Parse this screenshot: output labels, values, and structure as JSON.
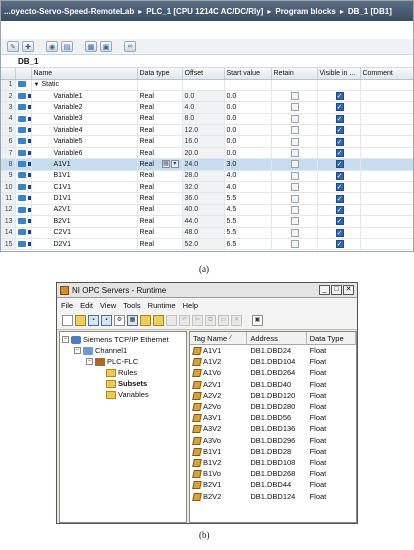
{
  "panel_a": {
    "breadcrumb": [
      "...oyecto-Servo-Speed-RemoteLab",
      "PLC_1 [CPU 1214C AC/DC/Rly]",
      "Program blocks",
      "DB_1 [DB1]"
    ],
    "block_title": "DB_1",
    "columns": [
      "Name",
      "Data type",
      "Offset",
      "Start value",
      "Retain",
      "Visible in ...",
      "Comment"
    ],
    "rows": [
      {
        "num": "1",
        "name": "Static",
        "type": "",
        "offset": "",
        "start": "",
        "header": true
      },
      {
        "num": "2",
        "name": "Variable1",
        "type": "Real",
        "offset": "0.0",
        "start": "0.0"
      },
      {
        "num": "3",
        "name": "Variable2",
        "type": "Real",
        "offset": "4.0",
        "start": "0.0"
      },
      {
        "num": "4",
        "name": "Variable3",
        "type": "Real",
        "offset": "8.0",
        "start": "0.0"
      },
      {
        "num": "5",
        "name": "Variable4",
        "type": "Real",
        "offset": "12.0",
        "start": "0.0"
      },
      {
        "num": "6",
        "name": "Variable5",
        "type": "Real",
        "offset": "16.0",
        "start": "0.0"
      },
      {
        "num": "7",
        "name": "Variable6",
        "type": "Real",
        "offset": "20.0",
        "start": "0.0"
      },
      {
        "num": "8",
        "name": "A1V1",
        "type": "Real",
        "offset": "24.0",
        "start": "3.0",
        "selected": true
      },
      {
        "num": "9",
        "name": "B1V1",
        "type": "Real",
        "offset": "28.0",
        "start": "4.0"
      },
      {
        "num": "10",
        "name": "C1V1",
        "type": "Real",
        "offset": "32.0",
        "start": "4.0"
      },
      {
        "num": "11",
        "name": "D1V1",
        "type": "Real",
        "offset": "36.0",
        "start": "5.5"
      },
      {
        "num": "12",
        "name": "A2V1",
        "type": "Real",
        "offset": "40.0",
        "start": "4.5"
      },
      {
        "num": "13",
        "name": "B2V1",
        "type": "Real",
        "offset": "44.0",
        "start": "5.5"
      },
      {
        "num": "14",
        "name": "C2V1",
        "type": "Real",
        "offset": "48.0",
        "start": "5.5"
      },
      {
        "num": "15",
        "name": "D2V1",
        "type": "Real",
        "offset": "52.0",
        "start": "6.5"
      }
    ],
    "caption": "(a)"
  },
  "panel_b": {
    "title": "NI OPC Servers - Runtime",
    "menu": [
      "File",
      "Edit",
      "View",
      "Tools",
      "Runtime",
      "Help"
    ],
    "tree": [
      {
        "label": "Siemens TCP/IP Ethernet",
        "bold": false
      },
      {
        "label": "Channel1",
        "bold": false
      },
      {
        "label": "PLC-FLC",
        "bold": false
      },
      {
        "label": "Rules",
        "bold": false
      },
      {
        "label": "Subsets",
        "bold": true
      },
      {
        "label": "Variables",
        "bold": false
      }
    ],
    "columns": [
      "Tag Name",
      "Address",
      "Data Type"
    ],
    "rows": [
      {
        "tag": "A1V1",
        "addr": "DB1.DBD24",
        "type": "Float"
      },
      {
        "tag": "A1V2",
        "addr": "DB1.DBD104",
        "type": "Float"
      },
      {
        "tag": "A1Vo",
        "addr": "DB1.DBD264",
        "type": "Float"
      },
      {
        "tag": "A2V1",
        "addr": "DB1.DBD40",
        "type": "Float"
      },
      {
        "tag": "A2V2",
        "addr": "DB1.DBD120",
        "type": "Float"
      },
      {
        "tag": "A2Vo",
        "addr": "DB1.DBD280",
        "type": "Float"
      },
      {
        "tag": "A3V1",
        "addr": "DB1.DBD56",
        "type": "Float"
      },
      {
        "tag": "A3V2",
        "addr": "DB1.DBD136",
        "type": "Float"
      },
      {
        "tag": "A3Vo",
        "addr": "DB1.DBD296",
        "type": "Float"
      },
      {
        "tag": "B1V1",
        "addr": "DB1.DBD28",
        "type": "Float"
      },
      {
        "tag": "B1V2",
        "addr": "DB1.DBD108",
        "type": "Float"
      },
      {
        "tag": "B1Vo",
        "addr": "DB1.DBD268",
        "type": "Float"
      },
      {
        "tag": "B2V1",
        "addr": "DB1.DBD44",
        "type": "Float"
      },
      {
        "tag": "B2V2",
        "addr": "DB1.DBD124",
        "type": "Float"
      }
    ],
    "caption": "(b)"
  }
}
